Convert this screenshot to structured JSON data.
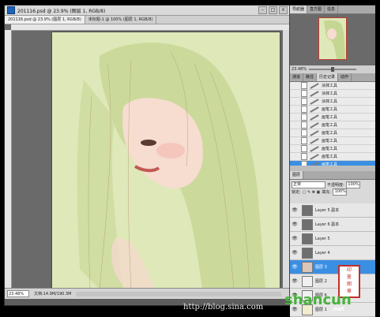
{
  "window": {
    "title": "201116.psd @ 23.9% (图层 1, RGB/8)",
    "tabs": [
      {
        "label": "201116.psd @ 23.9% (图层 1, RGB/8)",
        "active": true
      },
      {
        "label": "未标题-1 @ 100% (图层 1, RGB/8)",
        "active": false
      }
    ]
  },
  "status": {
    "zoom": "23.48%",
    "doc_info": "文档:14.9M/190.3M"
  },
  "panels": {
    "navigator_tabs": [
      "导航器",
      "直方图",
      "信息"
    ],
    "navigator_zoom": "23.48%",
    "history_tabs": [
      "通道",
      "路径",
      "历史记录",
      "动作"
    ],
    "history_items": [
      "涂抹工具",
      "涂抹工具",
      "涂抹工具",
      "画笔工具",
      "画笔工具",
      "画笔工具",
      "画笔工具",
      "画笔工具",
      "画笔工具",
      "画笔工具",
      "画笔工具"
    ],
    "history_selected_index": 10,
    "layers_tab": "图层",
    "blend_mode": "正常",
    "opacity_label": "不透明度:",
    "opacity_value": "100%",
    "lock_label": "锁定:",
    "fill_label": "填充:",
    "fill_value": "100%",
    "layers": [
      {
        "name": "Layer 5 副本",
        "color": "#6f6f6f"
      },
      {
        "name": "Layer 6 副本",
        "color": "#6f6f6f"
      },
      {
        "name": "Layer 5",
        "color": "#6f6f6f"
      },
      {
        "name": "Layer 4",
        "color": "#6f6f6f"
      },
      {
        "name": "图层 3",
        "color": "#d9c6b8",
        "selected": true
      },
      {
        "name": "图层 2",
        "color": "#f1f1f1"
      },
      {
        "name": "图层 6",
        "color": "#f1f1f1"
      },
      {
        "name": "图层 1",
        "color": "#f0eccc"
      }
    ]
  },
  "watermark": {
    "url": "http://blog.sina.com",
    "brand": "shancun",
    "brand_sub": ".net"
  }
}
